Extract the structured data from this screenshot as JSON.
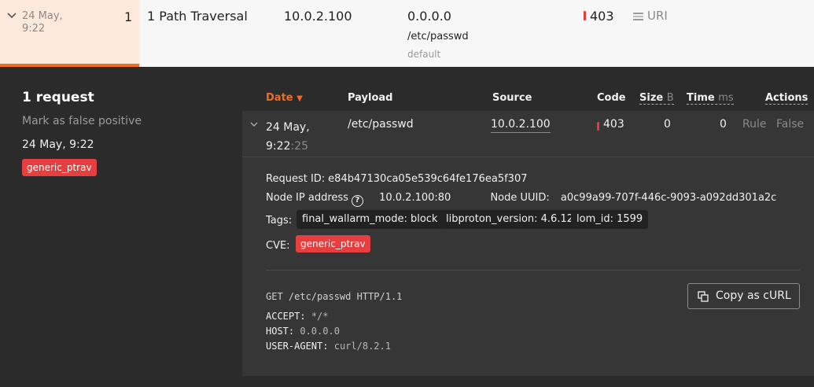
{
  "top_row": {
    "date_line1": "24 May,",
    "date_line2": "9:22",
    "count": "1",
    "attack": "1 Path Traversal",
    "source_ip": "10.0.2.100",
    "host": "0.0.0.0",
    "path": "/etc/passwd",
    "application": "default",
    "code": "403",
    "parameter_icon": "list-icon",
    "parameter": "URI"
  },
  "left_panel": {
    "title": "1 request",
    "false_positive": "Mark as false positive",
    "date": "24 May, 9:22",
    "badge": "generic_ptrav"
  },
  "table": {
    "headers": {
      "date": "Date",
      "payload": "Payload",
      "source": "Source",
      "code": "Code",
      "size": "Size",
      "size_unit": "B",
      "time": "Time",
      "time_unit": "ms",
      "actions": "Actions"
    },
    "row": {
      "date_line1": "24 May,",
      "date_line2": "9:22",
      "seconds": ":25",
      "payload": "/etc/passwd",
      "source": "10.0.2.100",
      "code": "403",
      "size": "0",
      "time": "0",
      "rule_action": "Rule",
      "false_action": "False"
    }
  },
  "detail": {
    "request_id_label": "Request ID:",
    "request_id": "e84b47130ca05e539c64fe176ea5f307",
    "node_ip_label": "Node IP address",
    "node_ip": "10.0.2.100:80",
    "node_uuid_label": "Node UUID:",
    "node_uuid": "a0c99a99-707f-446c-9093-a092dd301a2c",
    "tags_label": "Tags:",
    "tags": [
      "final_wallarm_mode: block",
      "libproton_version: 4.6.12",
      "lom_id: 1599"
    ],
    "cve_label": "CVE:",
    "cve": "generic_ptrav",
    "copy_button": "Copy as cURL",
    "request_line": "GET /etc/passwd HTTP/1.1",
    "headers": [
      {
        "key": "ACCEPT:",
        "value": "*/*"
      },
      {
        "key": "HOST:",
        "value": "0.0.0.0"
      },
      {
        "key": "USER-AGENT:",
        "value": "curl/8.2.1"
      }
    ]
  },
  "colors": {
    "accent": "#f26b22",
    "danger": "#e53f3f",
    "dark_bg": "#2b2b2b",
    "panel_bg": "#363636"
  }
}
